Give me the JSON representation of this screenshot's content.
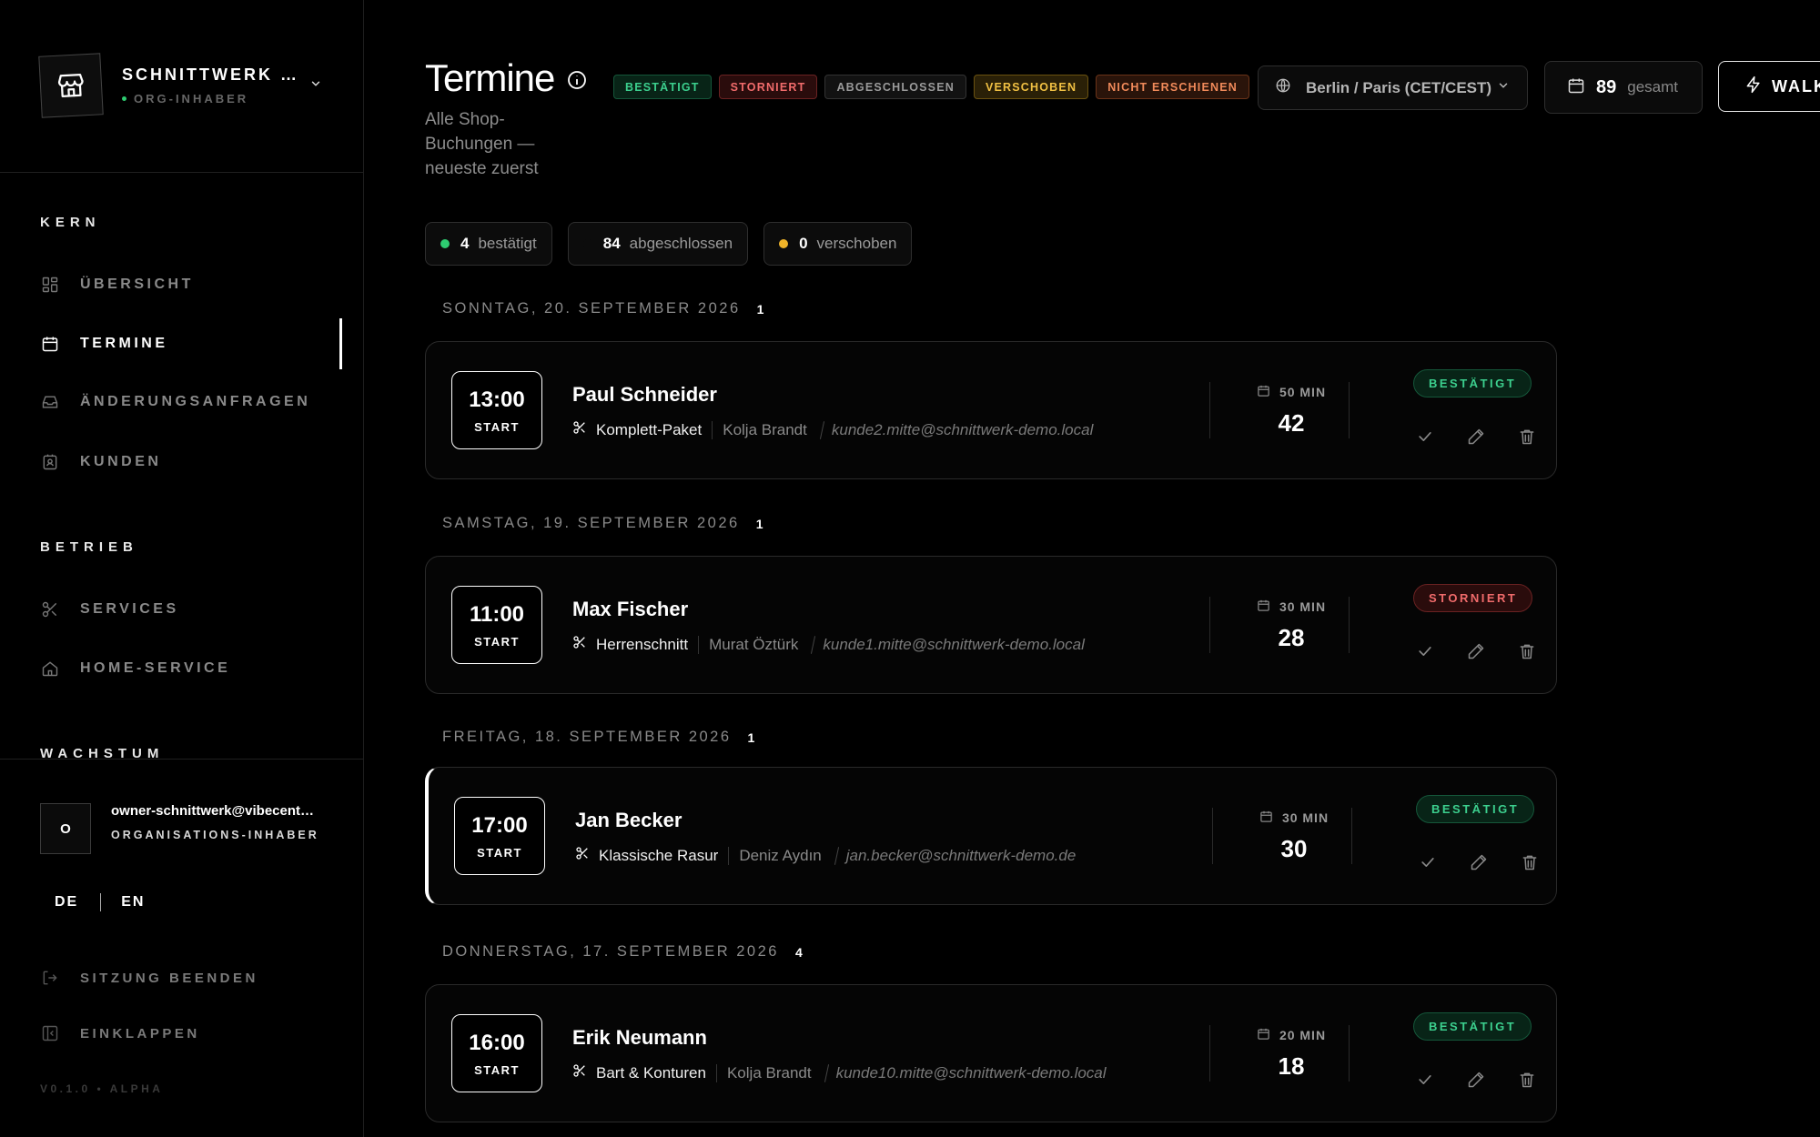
{
  "sidebar": {
    "org_name": "SCHNITTWERK …",
    "org_role": "ORG-INHABER",
    "sections": {
      "kern": "KERN",
      "betrieb": "BETRIEB",
      "wachstum": "WACHSTUM"
    },
    "items": [
      {
        "label": "ÜBERSICHT",
        "icon": "grid-icon"
      },
      {
        "label": "TERMINE",
        "icon": "calendar-icon",
        "active": true
      },
      {
        "label": "ÄNDERUNGSANFRAGEN",
        "icon": "inbox-icon"
      },
      {
        "label": "KUNDEN",
        "icon": "contact-icon"
      },
      {
        "label": "SERVICES",
        "icon": "scissors-icon"
      },
      {
        "label": "HOME-SERVICE",
        "icon": "home-icon"
      }
    ],
    "user": {
      "avatar_initial": "O",
      "email": "owner-schnittwerk@vibecent…",
      "role": "ORGANISATIONS-INHABER"
    },
    "lang": {
      "de": "DE",
      "en": "EN"
    },
    "logout": "SITZUNG BEENDEN",
    "collapse": "EINKLAPPEN",
    "version": "V0.1.0 • ALPHA"
  },
  "header": {
    "title": "Termine",
    "subtitle": "Alle Shop-Buchungen — neueste zuerst",
    "legend": [
      "BESTÄTIGT",
      "STORNIERT",
      "ABGESCHLOSSEN",
      "VERSCHOBEN",
      "NICHT ERSCHIENEN"
    ],
    "timezone": "Berlin / Paris (CET/CEST)",
    "total_count": "89",
    "total_label": "gesamt",
    "walkin_label": "WALK"
  },
  "stats": [
    {
      "count": "4",
      "label": "bestätigt",
      "color": "#2ecc71"
    },
    {
      "count": "84",
      "label": "abgeschlossen",
      "color": ""
    },
    {
      "count": "0",
      "label": "verschoben",
      "color": "#f0b429"
    }
  ],
  "days": [
    {
      "label": "SONNTAG, 20. SEPTEMBER 2026",
      "count": "1",
      "appointment": {
        "time": "13:00",
        "start_label": "START",
        "customer": "Paul Schneider",
        "service": "Komplett-Paket",
        "stylist": "Kolja Brandt",
        "email": "kunde2.mitte@schnittwerk-demo.local",
        "duration": "50 MIN",
        "number": "42",
        "status": "BESTÄTIGT",
        "status_type": "ok"
      }
    },
    {
      "label": "SAMSTAG, 19. SEPTEMBER 2026",
      "count": "1",
      "appointment": {
        "time": "11:00",
        "start_label": "START",
        "customer": "Max Fischer",
        "service": "Herrenschnitt",
        "stylist": "Murat Öztürk",
        "email": "kunde1.mitte@schnittwerk-demo.local",
        "duration": "30 MIN",
        "number": "28",
        "status": "STORNIERT",
        "status_type": "cx"
      }
    },
    {
      "label": "FREITAG, 18. SEPTEMBER 2026",
      "count": "1",
      "appointment": {
        "time": "17:00",
        "start_label": "START",
        "customer": "Jan Becker",
        "service": "Klassische Rasur",
        "stylist": "Deniz Aydın",
        "email": "jan.becker@schnittwerk-demo.de",
        "duration": "30 MIN",
        "number": "30",
        "status": "BESTÄTIGT",
        "status_type": "ok"
      }
    },
    {
      "label": "DONNERSTAG, 17. SEPTEMBER 2026",
      "count": "4",
      "appointment": {
        "time": "16:00",
        "start_label": "START",
        "customer": "Erik Neumann",
        "service": "Bart & Konturen",
        "stylist": "Kolja Brandt",
        "email": "kunde10.mitte@schnittwerk-demo.local",
        "duration": "20 MIN",
        "number": "18",
        "status": "BESTÄTIGT",
        "status_type": "ok"
      }
    }
  ]
}
